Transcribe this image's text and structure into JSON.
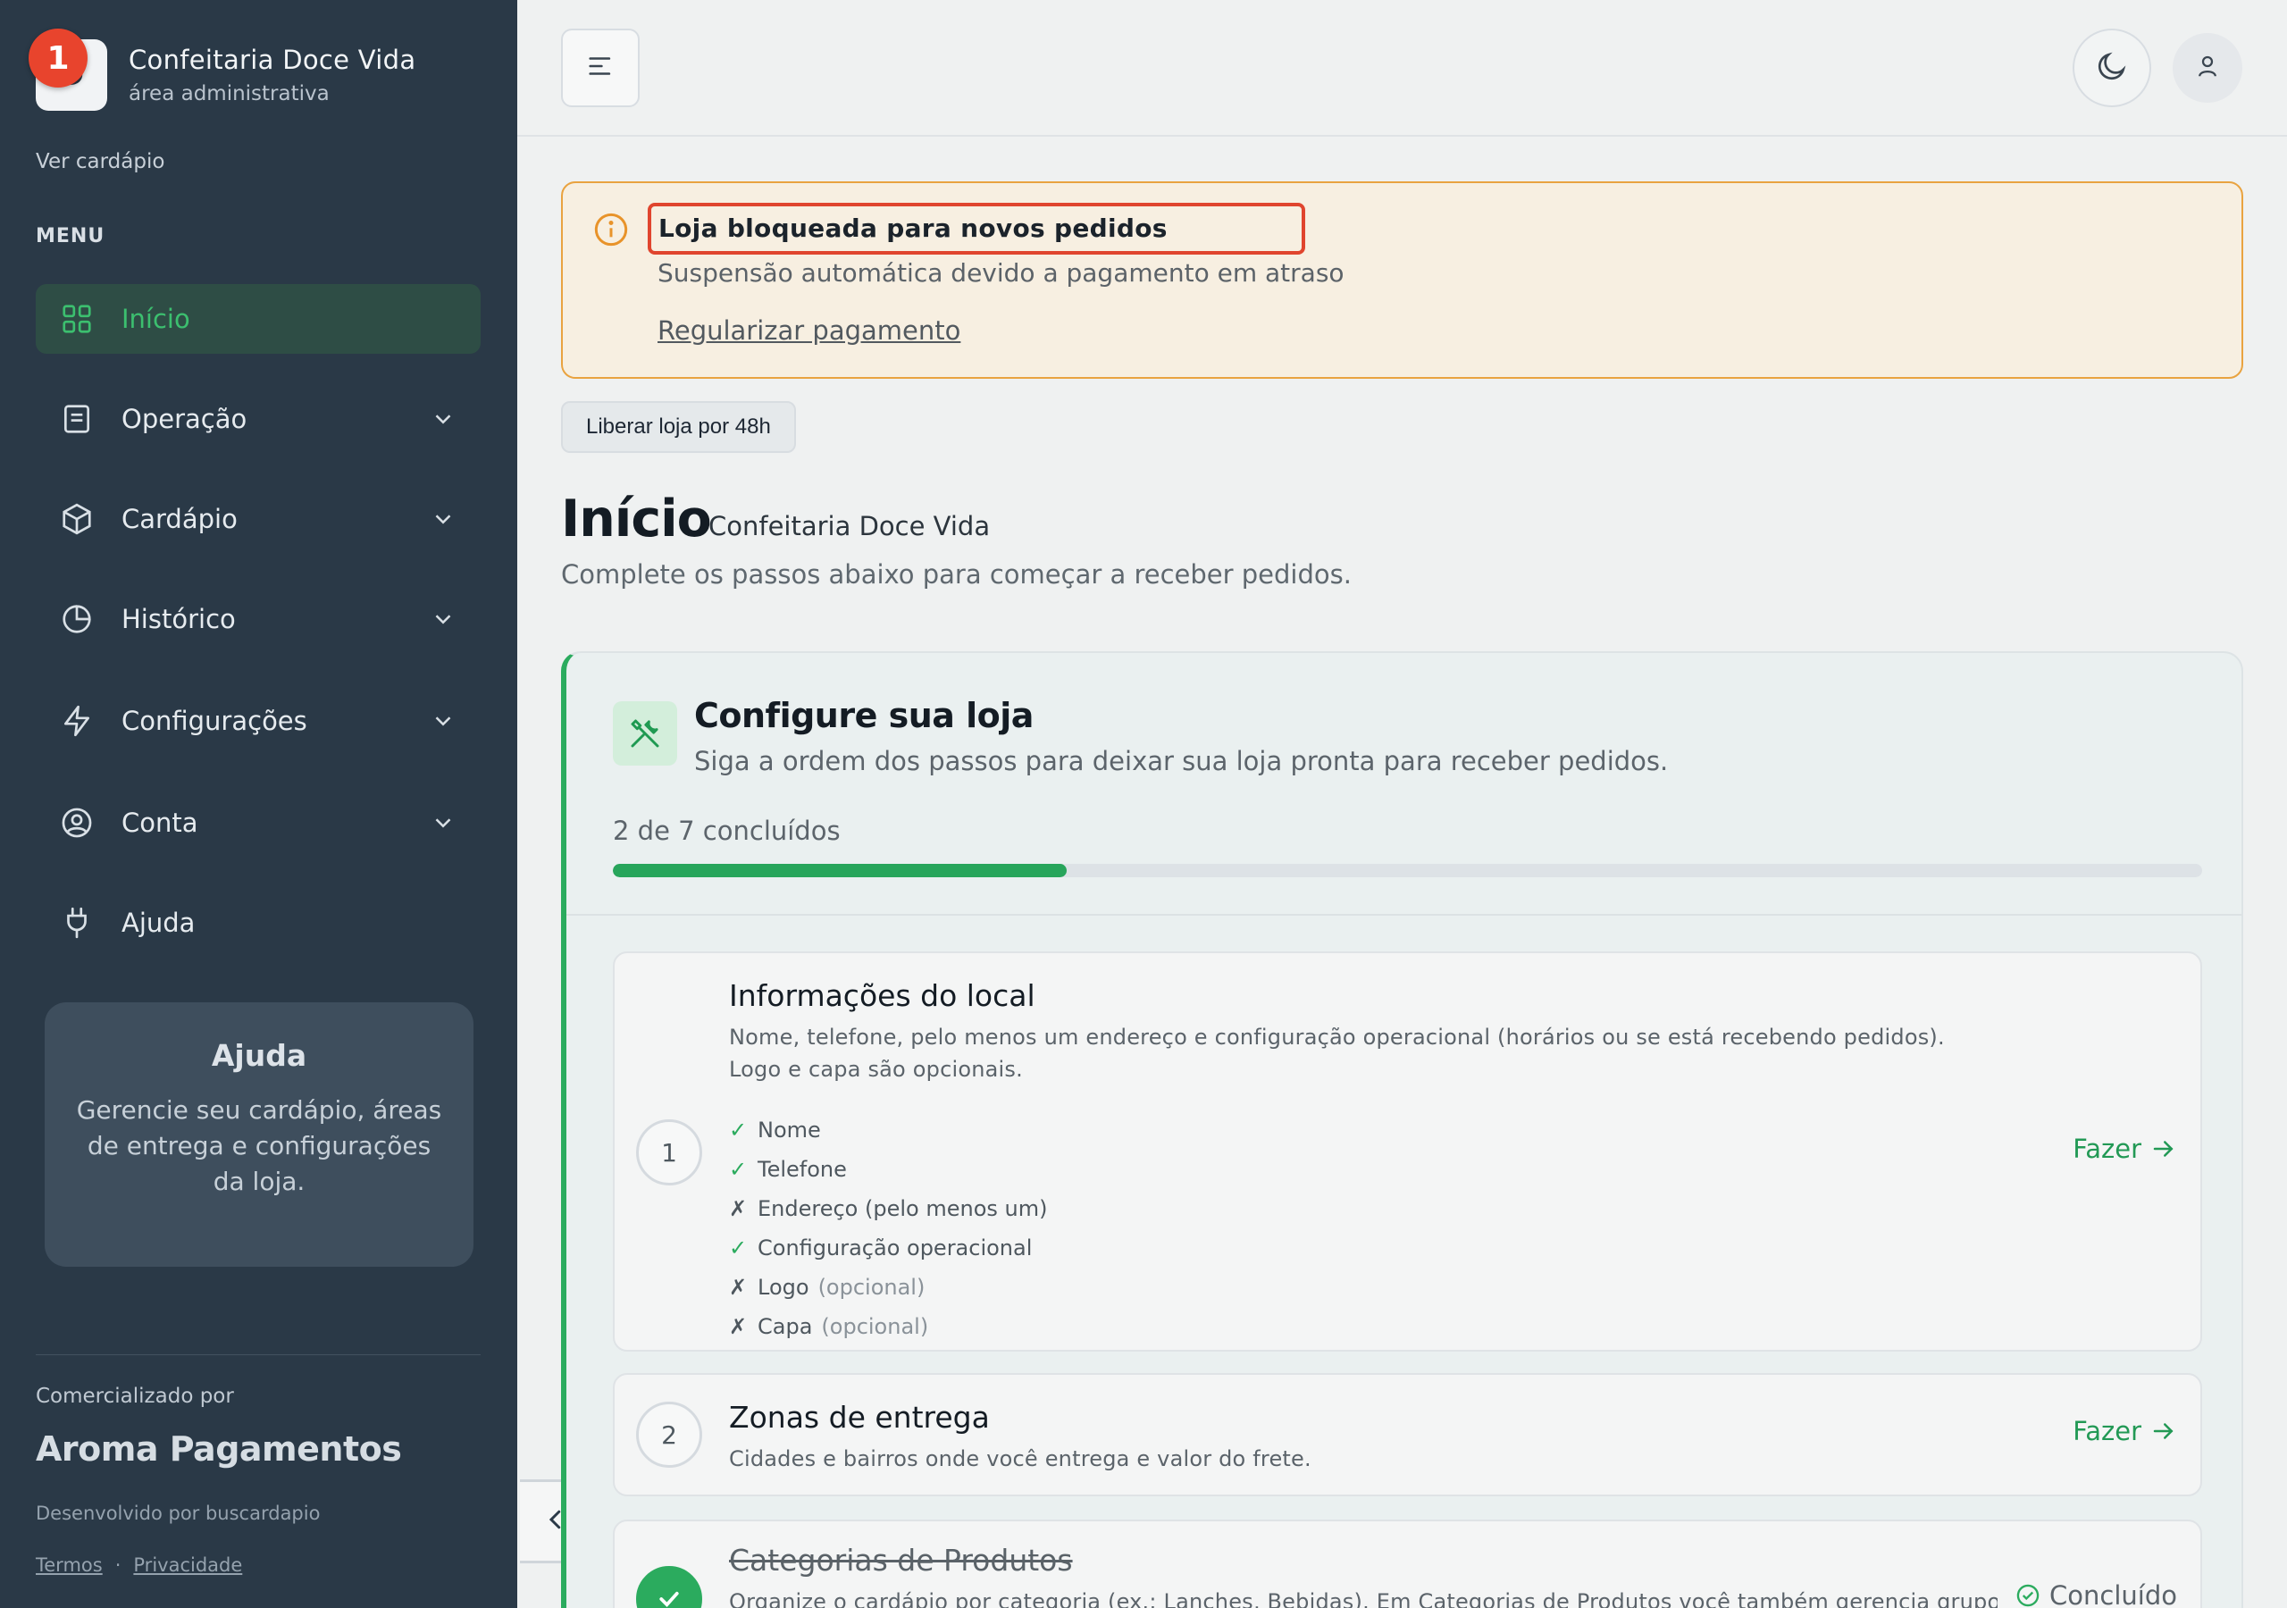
{
  "brand": {
    "logo_letter": "D",
    "name": "Confeitaria Doce Vida",
    "subtitle": "área administrativa",
    "badge": "1"
  },
  "sidebar": {
    "view_menu_link": "Ver cardápio",
    "menu_title": "MENU",
    "items": [
      {
        "label": "Início",
        "icon": "grid-icon",
        "active": true
      },
      {
        "label": "Operação",
        "icon": "document-icon"
      },
      {
        "label": "Cardápio",
        "icon": "box-icon"
      },
      {
        "label": "Histórico",
        "icon": "pie-chart-icon"
      },
      {
        "label": "Configurações",
        "icon": "lightning-icon"
      },
      {
        "label": "Conta",
        "icon": "user-circle-icon"
      },
      {
        "label": "Ajuda",
        "icon": "plug-icon"
      }
    ],
    "help_card": {
      "title": "Ajuda",
      "text": "Gerencie seu cardápio, áreas de entrega e configurações da loja."
    },
    "sold_by": "Comercializado por",
    "company": "Aroma Pagamentos",
    "developed_by": "Desenvolvido por buscardapio",
    "terms": "Termos",
    "separator": "·",
    "privacy": "Privacidade"
  },
  "alert": {
    "title": "Loja bloqueada para novos pedidos",
    "description": "Suspensão automática devido a pagamento em atraso",
    "link": "Regularizar pagamento"
  },
  "release_button": "Liberar loja por 48h",
  "page": {
    "title": "Início",
    "store_name": "Confeitaria Doce Vida",
    "description": "Complete os passos abaixo para começar a receber pedidos."
  },
  "setup": {
    "title": "Configure sua loja",
    "subtitle": "Siga a ordem dos passos para deixar sua loja pronta para receber pedidos.",
    "progress_text": "2 de 7 concluídos",
    "progress_fraction": 0.2857,
    "steps": [
      {
        "number": "1",
        "title": "Informações do local",
        "description": "Nome, telefone, pelo menos um endereço e configuração operacional (horários ou se está recebendo pedidos). Logo e capa são opcionais.",
        "checks": [
          {
            "mark": "✓",
            "done": true,
            "label": "Nome",
            "optional": ""
          },
          {
            "mark": "✓",
            "done": true,
            "label": "Telefone",
            "optional": ""
          },
          {
            "mark": "✗",
            "done": false,
            "label": "Endereço (pelo menos um)",
            "optional": ""
          },
          {
            "mark": "✓",
            "done": true,
            "label": "Configuração operacional",
            "optional": ""
          },
          {
            "mark": "✗",
            "done": false,
            "label": "Logo",
            "optional": "(opcional)"
          },
          {
            "mark": "✗",
            "done": false,
            "label": "Capa",
            "optional": "(opcional)"
          }
        ],
        "action": "Fazer"
      },
      {
        "number": "2",
        "title": "Zonas de entrega",
        "description": "Cidades e bairros onde você entrega e valor do frete.",
        "action": "Fazer"
      },
      {
        "title": "Categorias de Produtos",
        "description": "Organize o cardápio por categoria (ex.: Lanches, Bebidas). Em Categorias de Produtos você também gerencia grupos",
        "status": "Concluído"
      }
    ]
  }
}
